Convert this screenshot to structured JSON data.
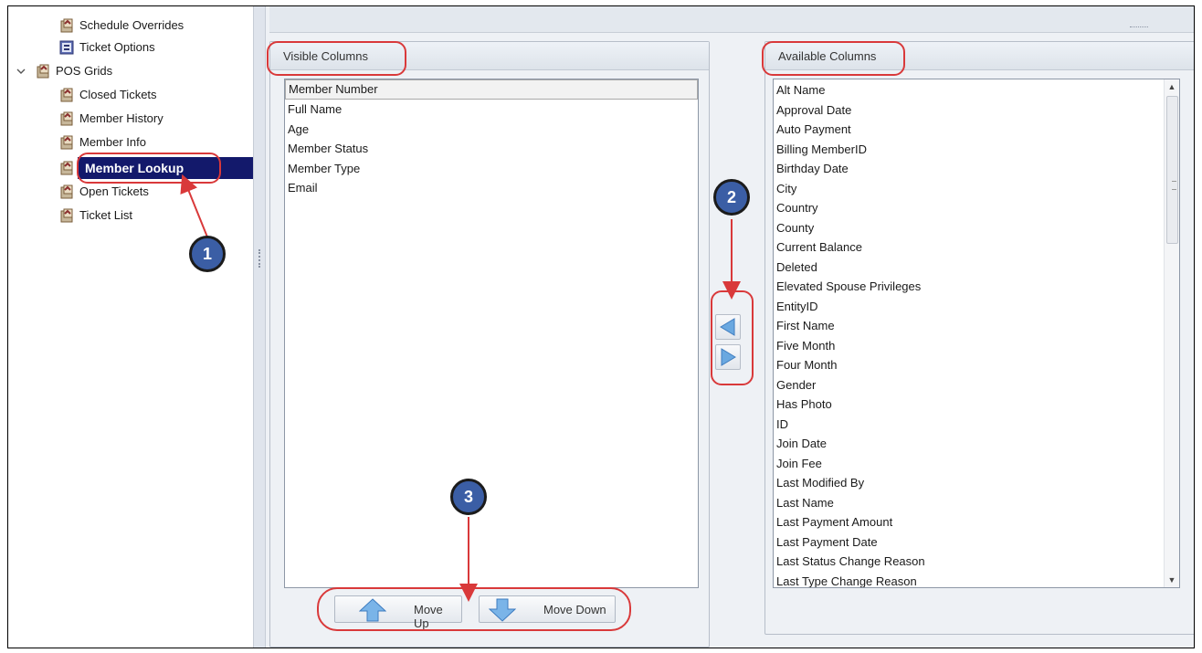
{
  "tree": {
    "items": [
      {
        "label": "Schedule Overrides",
        "icon": "report-icon"
      },
      {
        "label": "Ticket Options",
        "icon": "options-icon"
      },
      {
        "label": "POS Grids",
        "icon": "report-icon",
        "expanded": true
      },
      {
        "label": "Closed Tickets",
        "icon": "report-icon"
      },
      {
        "label": "Member History",
        "icon": "report-icon"
      },
      {
        "label": "Member Info",
        "icon": "report-icon"
      },
      {
        "label": "Member Lookup",
        "icon": "report-icon",
        "selected": true
      },
      {
        "label": "Open Tickets",
        "icon": "report-icon"
      },
      {
        "label": "Ticket List",
        "icon": "report-icon"
      }
    ]
  },
  "visible_columns": {
    "title": "Visible Columns",
    "items": [
      "Member Number",
      "Full Name",
      "Age",
      "Member Status",
      "Member Type",
      "Email"
    ],
    "selected_index": 0
  },
  "available_columns": {
    "title": "Available Columns",
    "items": [
      "Alt Name",
      "Approval Date",
      "Auto Payment",
      "Billing MemberID",
      "Birthday Date",
      "City",
      "Country",
      "County",
      "Current Balance",
      "Deleted",
      "Elevated Spouse Privileges",
      "EntityID",
      "First Name",
      "Five Month",
      "Four Month",
      "Gender",
      "Has Photo",
      "ID",
      "Join Date",
      "Join Fee",
      "Last Modified By",
      "Last Name",
      "Last Payment Amount",
      "Last Payment Date",
      "Last Status Change Reason",
      "Last Type Change Reason"
    ]
  },
  "buttons": {
    "move_up": "Move Up",
    "move_down": "Move Down"
  },
  "annotations": [
    "1",
    "2",
    "3"
  ],
  "colors": {
    "selection": "#13196b",
    "callout": "#d9393a",
    "badge": "#3b5ea5",
    "arrow": "#4a90d9"
  }
}
